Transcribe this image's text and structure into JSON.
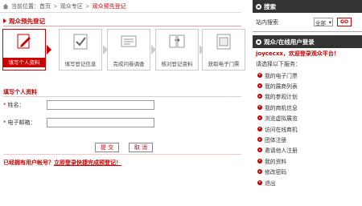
{
  "breadcrumb": {
    "prefix": "当前位置：",
    "items": [
      "首页",
      "观众专区",
      "观众预先登记"
    ],
    "separator": ">"
  },
  "section_title": "观众预先登记",
  "steps": [
    {
      "label": "填写个人资料",
      "icon": "pencil-paper-icon",
      "active": true
    },
    {
      "label": "填写登记信息",
      "icon": "checkmark-icon",
      "active": false
    },
    {
      "label": "完成问卷调查",
      "icon": "survey-icon",
      "active": false
    },
    {
      "label": "核对登记资料",
      "icon": "verify-icon",
      "active": false
    },
    {
      "label": "获取电子门票",
      "icon": "ticket-icon",
      "active": false
    }
  ],
  "form": {
    "title": "填写个人资料",
    "name_label": "姓名：",
    "name_value": "",
    "email_label": "电子邮箱：",
    "email_value": "",
    "required_mark": "*",
    "submit_label": "提 交",
    "cancel_label": "取 消"
  },
  "notice": {
    "text": "已经拥有用户帐号？",
    "link": "立即登录快捷完成预登记！"
  },
  "sidebar": {
    "search_header": "搜索",
    "search_label": "站内搜索",
    "search_select": "全部",
    "go_label": "GO",
    "user_header": "观众/在线用户登录",
    "welcome": "joycecxx，欢迎登录观众平台！",
    "choose": "请选择以下服务：",
    "menu": [
      "我的电子门票",
      "我的展商列表",
      "我的参观计划",
      "我的商机信息",
      "浏览虚拟展览",
      "访问在线商机",
      "团体注册",
      "邀请他人注册",
      "我的资料",
      "修改密码",
      "退出"
    ]
  },
  "colors": {
    "accent": "#cc0000",
    "header": "#333333"
  }
}
